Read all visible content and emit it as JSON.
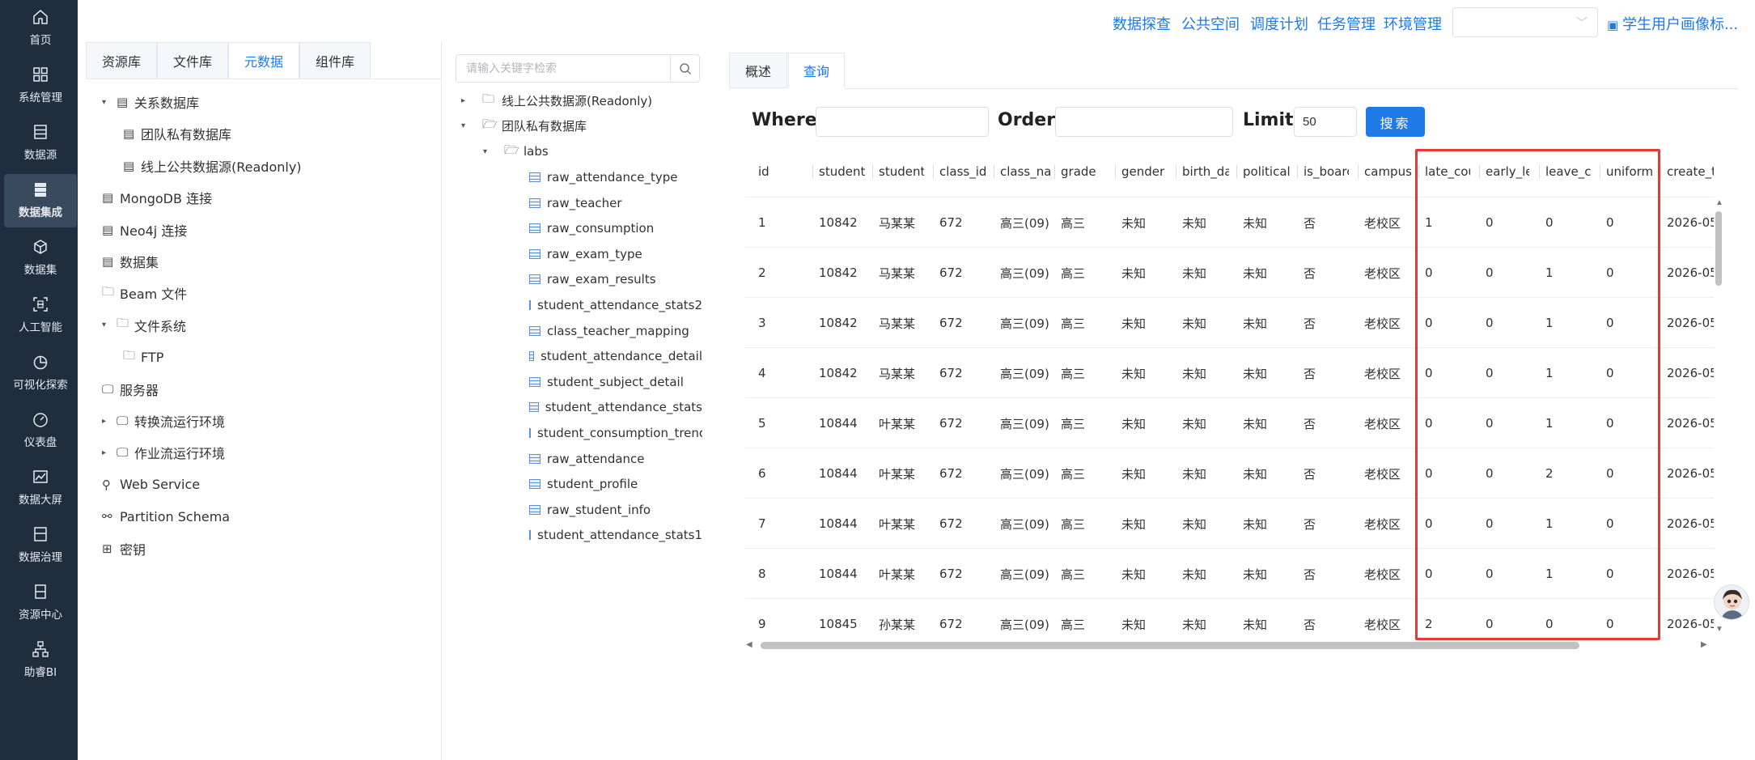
{
  "nav": {
    "items": [
      {
        "label": "首页",
        "icon": "home-icon"
      },
      {
        "label": "系统管理",
        "icon": "grid-icon"
      },
      {
        "label": "数据源",
        "icon": "database-icon"
      },
      {
        "label": "数据集成",
        "icon": "server-icon",
        "active": true
      },
      {
        "label": "数据集",
        "icon": "cube-icon"
      },
      {
        "label": "人工智能",
        "icon": "scan-icon"
      },
      {
        "label": "可视化探索",
        "icon": "pie-icon"
      },
      {
        "label": "仪表盘",
        "icon": "gauge-icon"
      },
      {
        "label": "数据大屏",
        "icon": "chart-icon"
      },
      {
        "label": "数据治理",
        "icon": "book-icon"
      },
      {
        "label": "资源中心",
        "icon": "file-icon"
      },
      {
        "label": "助睿BI",
        "icon": "org-icon"
      }
    ]
  },
  "header": {
    "links": [
      "数据探查",
      "公共空间",
      "调度计划",
      "任务管理",
      "环境管理"
    ],
    "select_value": "",
    "user_label": "学生用户画像标..."
  },
  "left_panel": {
    "tabs": [
      "资源库",
      "文件库",
      "元数据",
      "组件库"
    ],
    "active_tab": 2,
    "tree": [
      {
        "label": "关系数据库",
        "caret": "▾",
        "icon": "▤",
        "level": 1
      },
      {
        "label": "团队私有数据库",
        "caret": "",
        "icon": "▤",
        "level": 2
      },
      {
        "label": "线上公共数据源(Readonly)",
        "caret": "",
        "icon": "▤",
        "level": 2
      },
      {
        "label": "MongoDB 连接",
        "caret": "",
        "icon": "▤",
        "level": 0
      },
      {
        "label": "Neo4j 连接",
        "caret": "",
        "icon": "▤",
        "level": 0
      },
      {
        "label": "数据集",
        "caret": "",
        "icon": "▤",
        "level": 0
      },
      {
        "label": "Beam 文件",
        "caret": "",
        "icon": "🗀",
        "level": 0
      },
      {
        "label": "文件系统",
        "caret": "▾",
        "icon": "🗀",
        "level": 1
      },
      {
        "label": "FTP",
        "caret": "",
        "icon": "🗀",
        "level": 2
      },
      {
        "label": "服务器",
        "caret": "",
        "icon": "🖵",
        "level": 0
      },
      {
        "label": "转换流运行环境",
        "caret": "▸",
        "icon": "🖵",
        "level": 1
      },
      {
        "label": "作业流运行环境",
        "caret": "▸",
        "icon": "🖵",
        "level": 1
      },
      {
        "label": "Web Service",
        "caret": "",
        "icon": "⚲",
        "level": 0
      },
      {
        "label": "Partition Schema",
        "caret": "",
        "icon": "⚯",
        "level": 0
      },
      {
        "label": "密钥",
        "caret": "",
        "icon": "⊞",
        "level": 0
      }
    ]
  },
  "middle_panel": {
    "search_placeholder": "请输入关键字检索",
    "tree": [
      {
        "label": "线上公共数据源(Readonly)",
        "caret": "▸",
        "icon": "🗀"
      },
      {
        "label": "团队私有数据库",
        "caret": "▾",
        "icon": "🗁"
      },
      {
        "label": "labs",
        "caret": "▾",
        "icon": "🗁"
      }
    ],
    "tables": [
      "raw_attendance_type",
      "raw_teacher",
      "raw_consumption",
      "raw_exam_type",
      "raw_exam_results",
      "student_attendance_stats2",
      "class_teacher_mapping",
      "student_attendance_detail",
      "student_subject_detail",
      "student_attendance_stats",
      "student_consumption_trenc",
      "raw_attendance",
      "student_profile",
      "raw_student_info",
      "student_attendance_stats1"
    ]
  },
  "query": {
    "tabs": [
      "概述",
      "查询"
    ],
    "active_tab": 1,
    "where_label": "Where",
    "where_value": "",
    "order_label": "Order",
    "order_value": "",
    "limit_label": "Limit",
    "limit_value": "50",
    "search_label": "搜索"
  },
  "grid": {
    "columns": [
      "id",
      "student",
      "student",
      "class_id",
      "class_na",
      "grade",
      "gender",
      "birth_da",
      "political",
      "is_boarc",
      "campus",
      "late_cou",
      "early_le",
      "leave_cc",
      "uniform",
      "create_t"
    ],
    "rows": [
      [
        "1",
        "10842",
        "马某某",
        "672",
        "高三(09)",
        "高三",
        "未知",
        "未知",
        "未知",
        "否",
        "老校区",
        "1",
        "0",
        "0",
        "0",
        "2026-05"
      ],
      [
        "2",
        "10842",
        "马某某",
        "672",
        "高三(09)",
        "高三",
        "未知",
        "未知",
        "未知",
        "否",
        "老校区",
        "0",
        "0",
        "1",
        "0",
        "2026-05"
      ],
      [
        "3",
        "10842",
        "马某某",
        "672",
        "高三(09)",
        "高三",
        "未知",
        "未知",
        "未知",
        "否",
        "老校区",
        "0",
        "0",
        "1",
        "0",
        "2026-05"
      ],
      [
        "4",
        "10842",
        "马某某",
        "672",
        "高三(09)",
        "高三",
        "未知",
        "未知",
        "未知",
        "否",
        "老校区",
        "0",
        "0",
        "1",
        "0",
        "2026-05"
      ],
      [
        "5",
        "10844",
        "叶某某",
        "672",
        "高三(09)",
        "高三",
        "未知",
        "未知",
        "未知",
        "否",
        "老校区",
        "0",
        "0",
        "1",
        "0",
        "2026-05"
      ],
      [
        "6",
        "10844",
        "叶某某",
        "672",
        "高三(09)",
        "高三",
        "未知",
        "未知",
        "未知",
        "否",
        "老校区",
        "0",
        "0",
        "2",
        "0",
        "2026-05"
      ],
      [
        "7",
        "10844",
        "叶某某",
        "672",
        "高三(09)",
        "高三",
        "未知",
        "未知",
        "未知",
        "否",
        "老校区",
        "0",
        "0",
        "1",
        "0",
        "2026-05"
      ],
      [
        "8",
        "10844",
        "叶某某",
        "672",
        "高三(09)",
        "高三",
        "未知",
        "未知",
        "未知",
        "否",
        "老校区",
        "0",
        "0",
        "1",
        "0",
        "2026-05"
      ],
      [
        "9",
        "10845",
        "孙某某",
        "672",
        "高三(09)",
        "高三",
        "未知",
        "未知",
        "未知",
        "否",
        "老校区",
        "2",
        "0",
        "0",
        "0",
        "2026-05"
      ]
    ]
  },
  "colors": {
    "accent": "#1e7ae6",
    "nav_bg": "#1f2d3d",
    "highlight": "#e53935"
  }
}
